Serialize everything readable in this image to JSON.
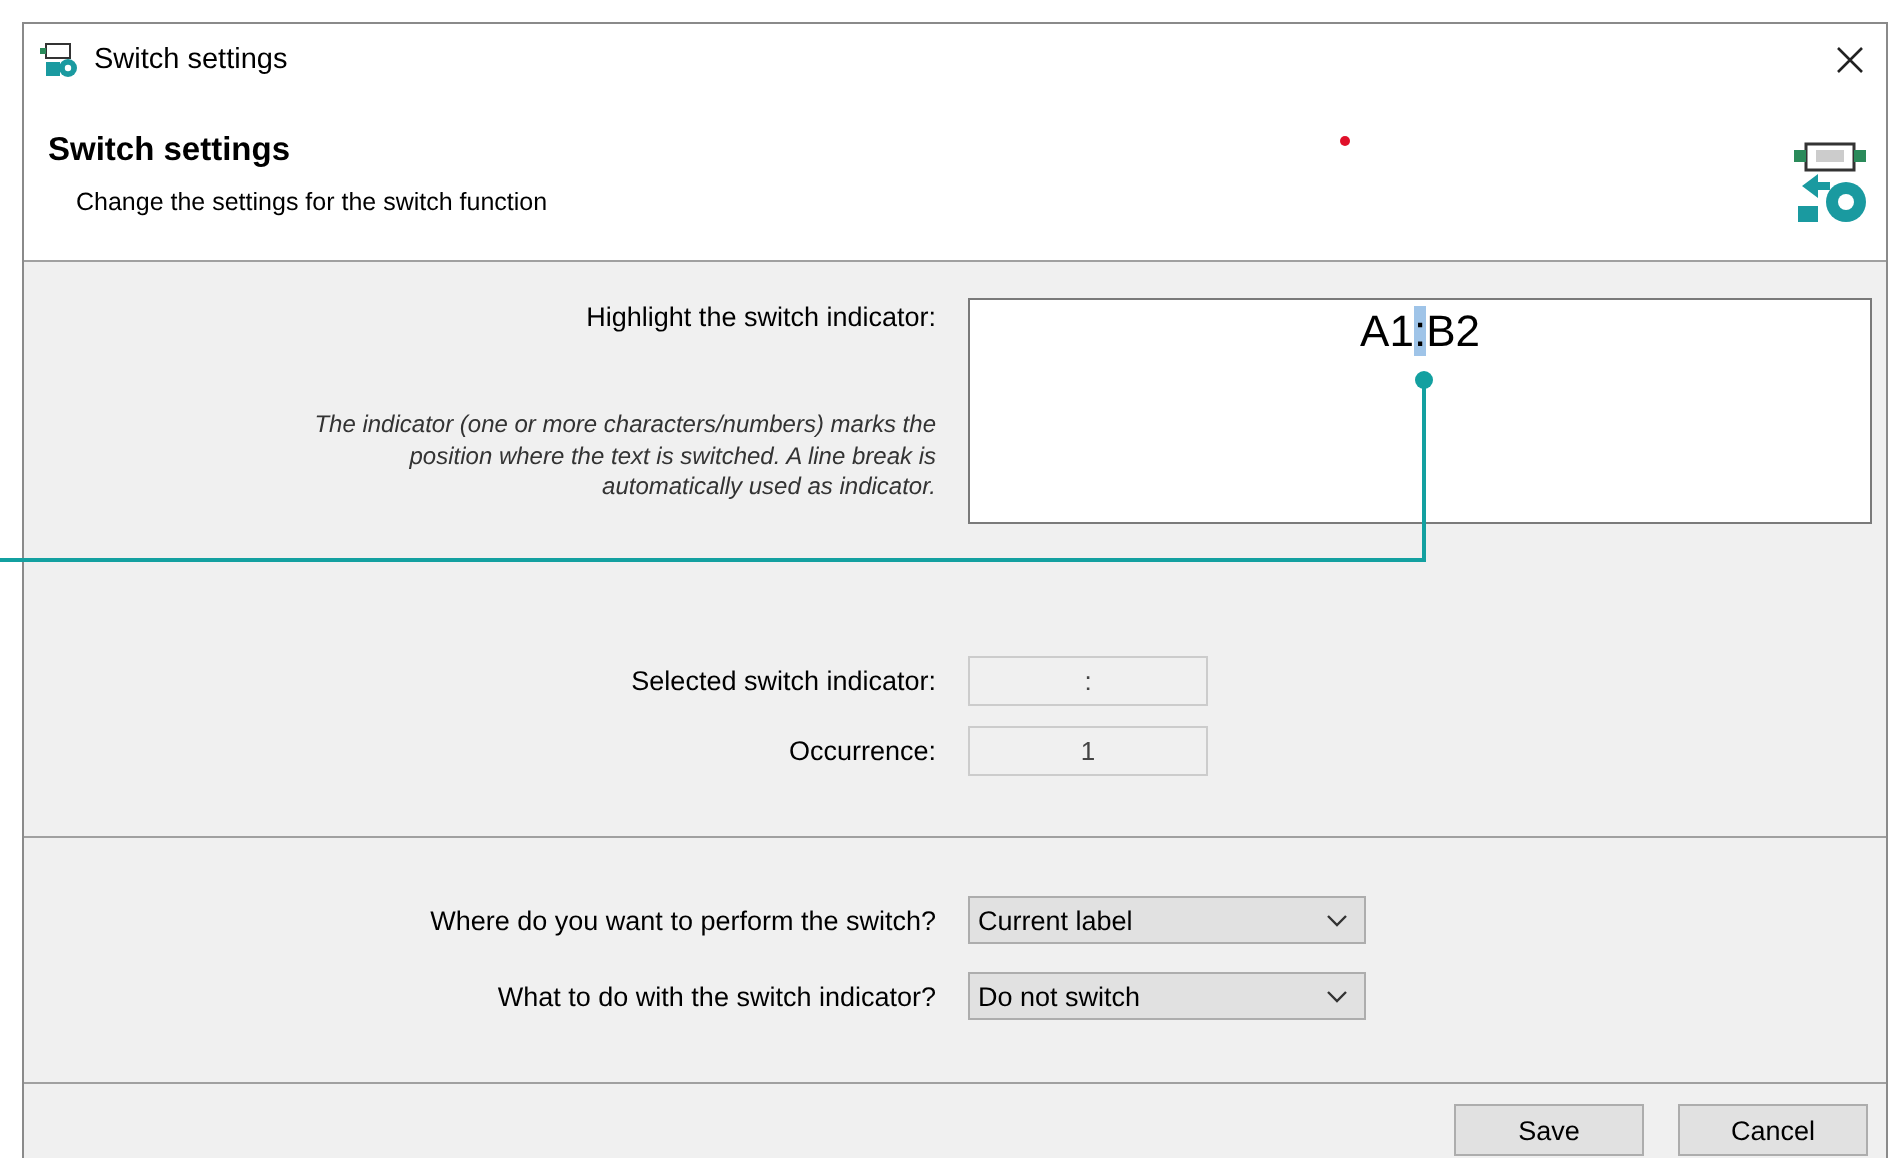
{
  "window": {
    "title": "Switch settings"
  },
  "header": {
    "title": "Switch settings",
    "subtitle": "Change the settings for the switch function"
  },
  "indicator_editor": {
    "label": "Highlight the switch indicator:",
    "note": "The indicator (one or more characters/numbers) marks the position where the text is switched. A line break is automatically used as indicator.",
    "text_parts": [
      {
        "text": "A1",
        "selected": false
      },
      {
        "text": ":",
        "selected": true
      },
      {
        "text": "B2",
        "selected": false
      }
    ]
  },
  "fields": [
    {
      "label": "Selected switch indicator:",
      "value": ":",
      "disabled": true
    },
    {
      "label": "Occurrence:",
      "value": "1",
      "disabled": true
    }
  ],
  "dropdowns": [
    {
      "label": "Where do you want to perform the switch?",
      "value": "Current label"
    },
    {
      "label": "What to do with the switch indicator?",
      "value": "Do not switch"
    }
  ],
  "buttons": [
    "Save",
    "Cancel"
  ]
}
